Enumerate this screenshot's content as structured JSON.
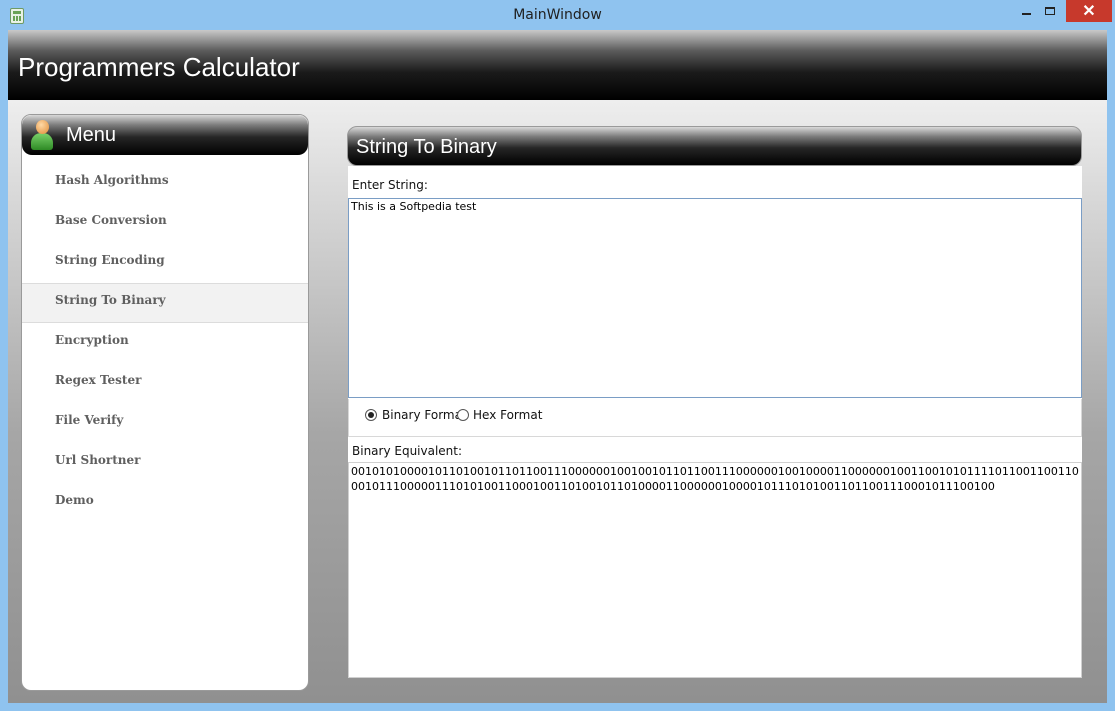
{
  "window": {
    "title": "MainWindow",
    "close_glyph": "✕"
  },
  "header": {
    "title": "Programmers Calculator"
  },
  "menu": {
    "title": "Menu",
    "items": [
      {
        "label": "Hash Algorithms"
      },
      {
        "label": "Base Conversion"
      },
      {
        "label": "String Encoding"
      },
      {
        "label": "String To Binary",
        "active": true
      },
      {
        "label": "Encryption"
      },
      {
        "label": "Regex Tester"
      },
      {
        "label": "File Verify"
      },
      {
        "label": "Url Shortner"
      },
      {
        "label": "Demo"
      }
    ]
  },
  "content": {
    "title": "String To Binary",
    "enter_label": "Enter String:",
    "input_value": "This is a Softpedia test",
    "format": {
      "binary_label": "Binary Format",
      "hex_label": "Hex Format",
      "selected": "binary"
    },
    "equivalent_label": "Binary Equivalent:",
    "output_value": "0010101000010110100101101100111000000100100101101100111000000100100001100000010011001010111101100110011000101110000011101010011000100110100101101000011000000100001011101010011011001110001011100100"
  },
  "colors": {
    "titlebar": "#8fc3ef",
    "close_button": "#c7392c",
    "menu_text": "#5f5f5f"
  }
}
